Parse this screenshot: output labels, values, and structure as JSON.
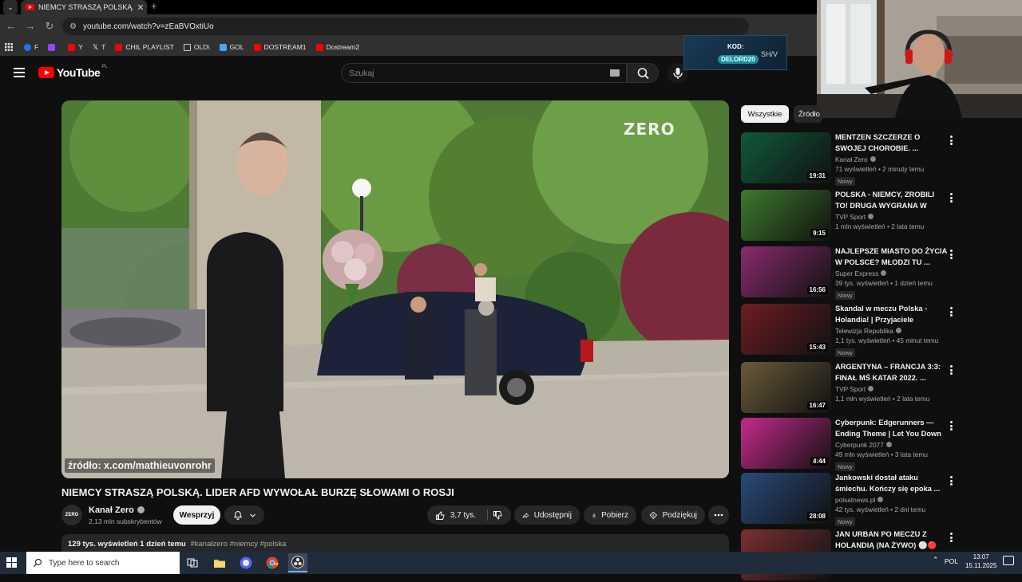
{
  "browser": {
    "tab_title": "NIEMCY STRASZĄ POLSKĄ. LIDE",
    "url": "youtube.com/watch?v=zEaBVOxtiUo",
    "bookmarks": [
      {
        "label": "F",
        "color": "#1877f2"
      },
      {
        "label": "",
        "color": "#9146ff"
      },
      {
        "label": "Y",
        "color": "#ff0000"
      },
      {
        "label": "T",
        "color": "#ffffff"
      },
      {
        "label": "CHIL PLAYLIST",
        "color": "#ff0000"
      },
      {
        "label": "OLD\\",
        "color": "#cccccc"
      },
      {
        "label": "GOL",
        "color": "#4aa3ff"
      },
      {
        "label": "DOSTREAM1",
        "color": "#ff0000"
      },
      {
        "label": "Dostream2",
        "color": "#ff0000"
      }
    ]
  },
  "overlay_code": {
    "label": "KOD:",
    "code": "DELORD20",
    "brand": "SH/V"
  },
  "youtube": {
    "logo_text": "YouTube",
    "region": "PL",
    "search_placeholder": "Szukaj"
  },
  "video": {
    "watermark": "ZERO",
    "source_caption": "źródło: x.com/mathieuvonrohr",
    "title": "NIEMCY STRASZĄ POLSKĄ. LIDER AFD WYWOŁAŁ BURZĘ SŁOWAMI O ROSJI",
    "channel_name": "Kanał Zero",
    "channel_avatar_text": "ZERO",
    "subscribers": "2,13 mln subskrybentów",
    "support_label": "Wesprzyj",
    "likes": "3,7 tys.",
    "share_label": "Udostępnij",
    "download_label": "Pobierz",
    "thanks_label": "Podziękuj",
    "stats": "129 tys. wyświetleń  1 dzień temu",
    "hashtags": "#kanałzero #niemcy #polska"
  },
  "chips": {
    "all": "Wszystkie",
    "source": "Źródło"
  },
  "recommendations": [
    {
      "title": "MENTZEN SZCZERZE O SWOJEJ CHOROBIE. ...",
      "channel": "Kanał Zero",
      "meta": "71 wyświetleń • 2 minuty temu",
      "badge": "Nowy",
      "duration": "19:31",
      "thumb_color": "#0f5a3a"
    },
    {
      "title": "POLSKA - NIEMCY, ZROBILI TO! DRUGA WYGRANA W HISTORI...",
      "channel": "TVP Sport",
      "meta": "1 mln wyświetleń • 2 lata temu",
      "badge": "",
      "duration": "9:15",
      "thumb_color": "#3d7a2d"
    },
    {
      "title": "NAJLEPSZE MIASTO DO ŻYCIA W POLSCE? MŁODZI TU ...",
      "channel": "Super Express",
      "meta": "39 tys. wyświetleń • 1 dzień temu",
      "badge": "Nowy",
      "duration": "16:56",
      "thumb_color": "#8a2b6e"
    },
    {
      "title": "Skandal w meczu Polska - Holandia! | Przyjaciele Republiki",
      "channel": "Telewizja Republika",
      "meta": "1,1 tys. wyświetleń • 45 minut temu",
      "badge": "Nowy",
      "duration": "15:43",
      "thumb_color": "#6e1e22"
    },
    {
      "title": "ARGENTYNA – FRANCJA 3:3: FINAŁ MŚ KATAR 2022. ...",
      "channel": "TVP Sport",
      "meta": "1,1 mln wyświetleń • 2 lata temu",
      "badge": "",
      "duration": "16:47",
      "thumb_color": "#6a5a3a"
    },
    {
      "title": "Cyberpunk: Edgerunners — Ending Theme | Let You Down ...",
      "channel": "Cyberpunk 2077",
      "meta": "49 mln wyświetleń • 3 lata temu",
      "badge": "Nowy",
      "duration": "4:44",
      "thumb_color": "#c62a8c"
    },
    {
      "title": "Jankowski dostał ataku śmiechu. Kończy się epoka ...",
      "channel": "polsatnews.pl",
      "meta": "42 tys. wyświetleń • 2 dni temu",
      "badge": "Nowy",
      "duration": "28:08",
      "thumb_color": "#2a4a7a"
    },
    {
      "title": "JAN URBAN PO MECZU Z HOLANDIĄ (NA ŻYWO) ⚪🔴",
      "channel": "",
      "meta": "",
      "badge": "",
      "duration": "",
      "thumb_color": "#7a3030"
    }
  ],
  "taskbar": {
    "search_placeholder": "Type here to search",
    "language": "POL",
    "time": "13:07",
    "date": "15.11.2025"
  }
}
